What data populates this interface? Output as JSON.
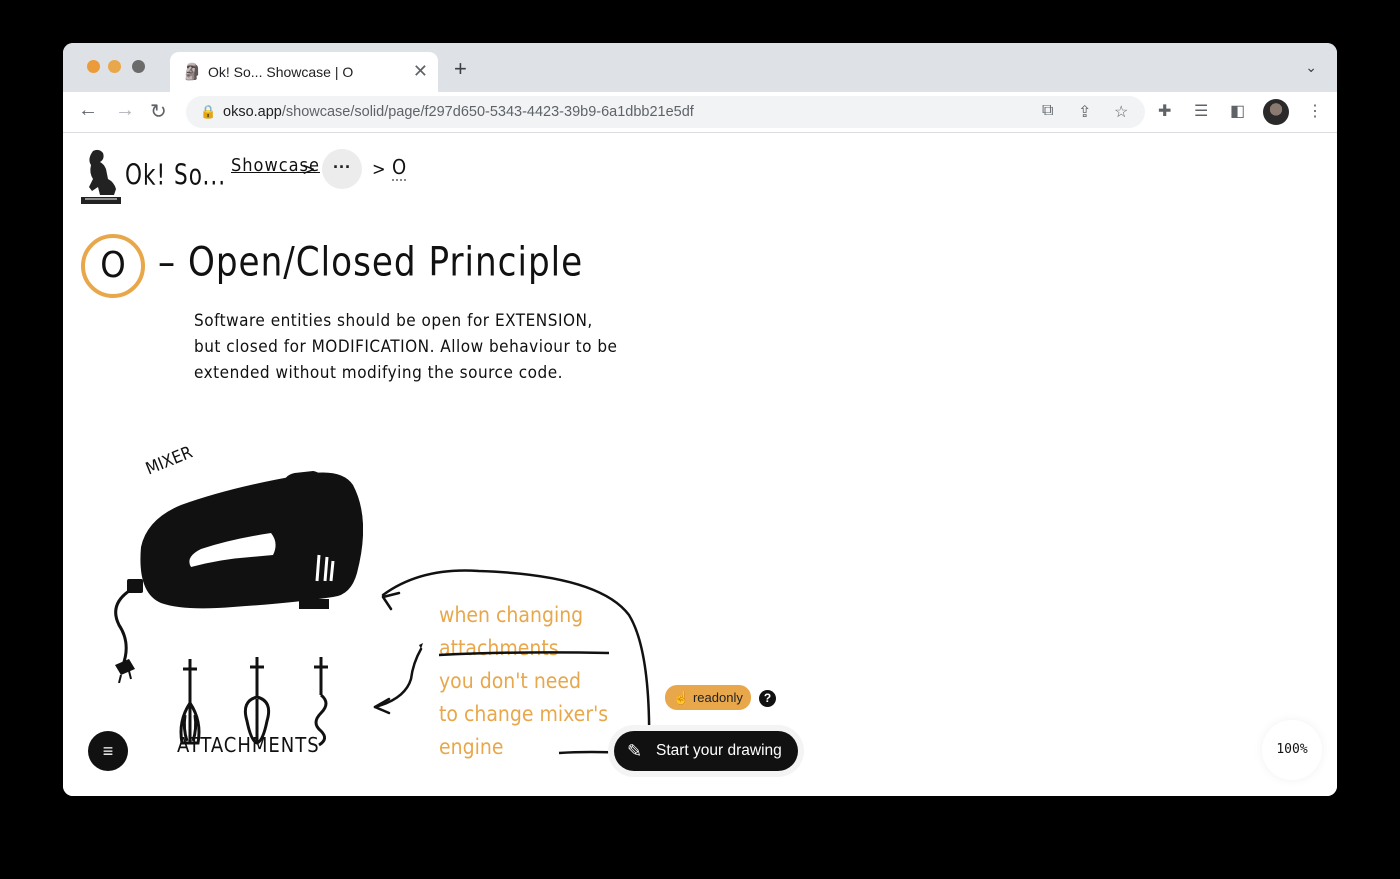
{
  "browser": {
    "tab_title": "Ok! So... Showcase | O",
    "url_host": "okso.app",
    "url_path": "/showcase/solid/page/f297d650-5343-4423-39b9-6a1dbb21e5df"
  },
  "app": {
    "logo_text": "Ok! So...",
    "breadcrumb": {
      "showcase": "Showcase",
      "separator": ">",
      "more": "···",
      "current": "O"
    },
    "page_letter": "O",
    "page_title": "– Open/Closed Principle",
    "description": [
      "Software entities should be open for EXTENSION,",
      "but closed for MODIFICATION. Allow behaviour to be",
      "extended without modifying the source code."
    ],
    "drawing": {
      "mixer_label": "MIXER",
      "attachments_label": "ATTACHMENTS",
      "note_lines": [
        "when changing",
        "attachments",
        "you don't need",
        "to change mixer's",
        "engine"
      ]
    },
    "readonly_badge": "readonly",
    "help_label": "?",
    "start_drawing": "Start your drawing",
    "zoom": "100%"
  },
  "colors": {
    "accent": "#e8a74b",
    "ink": "#111111"
  }
}
